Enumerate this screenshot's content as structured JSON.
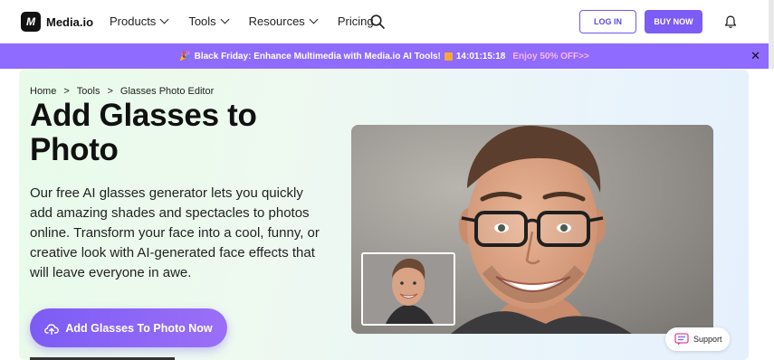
{
  "header": {
    "logo_mark": "M",
    "logo_text": "Media.io",
    "nav": [
      {
        "label": "Products",
        "dropdown": true
      },
      {
        "label": "Tools",
        "dropdown": true
      },
      {
        "label": "Resources",
        "dropdown": true
      },
      {
        "label": "Pricing",
        "dropdown": false
      }
    ],
    "login_label": "LOG IN",
    "buy_label": "BUY NOW",
    "icons": [
      "search-icon",
      "bell-icon"
    ]
  },
  "promo": {
    "text": "Black Friday: Enhance Multimedia with Media.io AI Tools!",
    "countdown": "14:01:15:18",
    "offer": "Enjoy 50% OFF>>",
    "close": "✕",
    "background": "#8f6bff",
    "offer_color": "#ffb3e6"
  },
  "breadcrumb": [
    "Home",
    ">",
    "Tools",
    ">",
    "Glasses Photo Editor"
  ],
  "hero": {
    "title": "Add Glasses to Photo",
    "description": "Our free AI glasses generator lets you quickly add amazing shades and spectacles to photos online. Transform your face into a cool, funny, or creative look with AI-generated face effects that will leave everyone in awe.",
    "cta_label": "Add Glasses To Photo Now",
    "accent": "#7c5cf5"
  },
  "support": {
    "label": "Support"
  }
}
